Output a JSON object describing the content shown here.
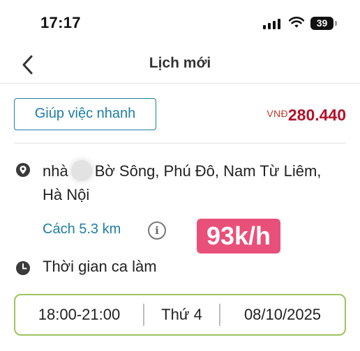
{
  "status_bar": {
    "time": "17:17",
    "battery": "39"
  },
  "nav": {
    "title": "Lịch mới"
  },
  "job": {
    "service_label": "Giúp việc nhanh",
    "price_currency": "VNĐ",
    "price_value": "280.440",
    "address_prefix": "nhà",
    "address_rest": "Bờ Sông, Phú Đô, Nam Từ Liêm, Hà Nội",
    "distance": "Cách 5.3 km",
    "speed_badge": "93k/h",
    "shift_label": "Thời gian ca làm",
    "schedule": {
      "time_range": "18:00-21:00",
      "weekday": "Thứ 4",
      "date": "08/10/2025"
    }
  },
  "icons": {
    "back": "chevron-left-icon",
    "location": "map-pin-icon",
    "info": "info-icon",
    "clock": "clock-icon"
  },
  "colors": {
    "accent_blue": "#1e7ea3",
    "price_red": "#b3122a",
    "badge_pink": "#e8507a",
    "schedule_border": "#9dc460"
  }
}
